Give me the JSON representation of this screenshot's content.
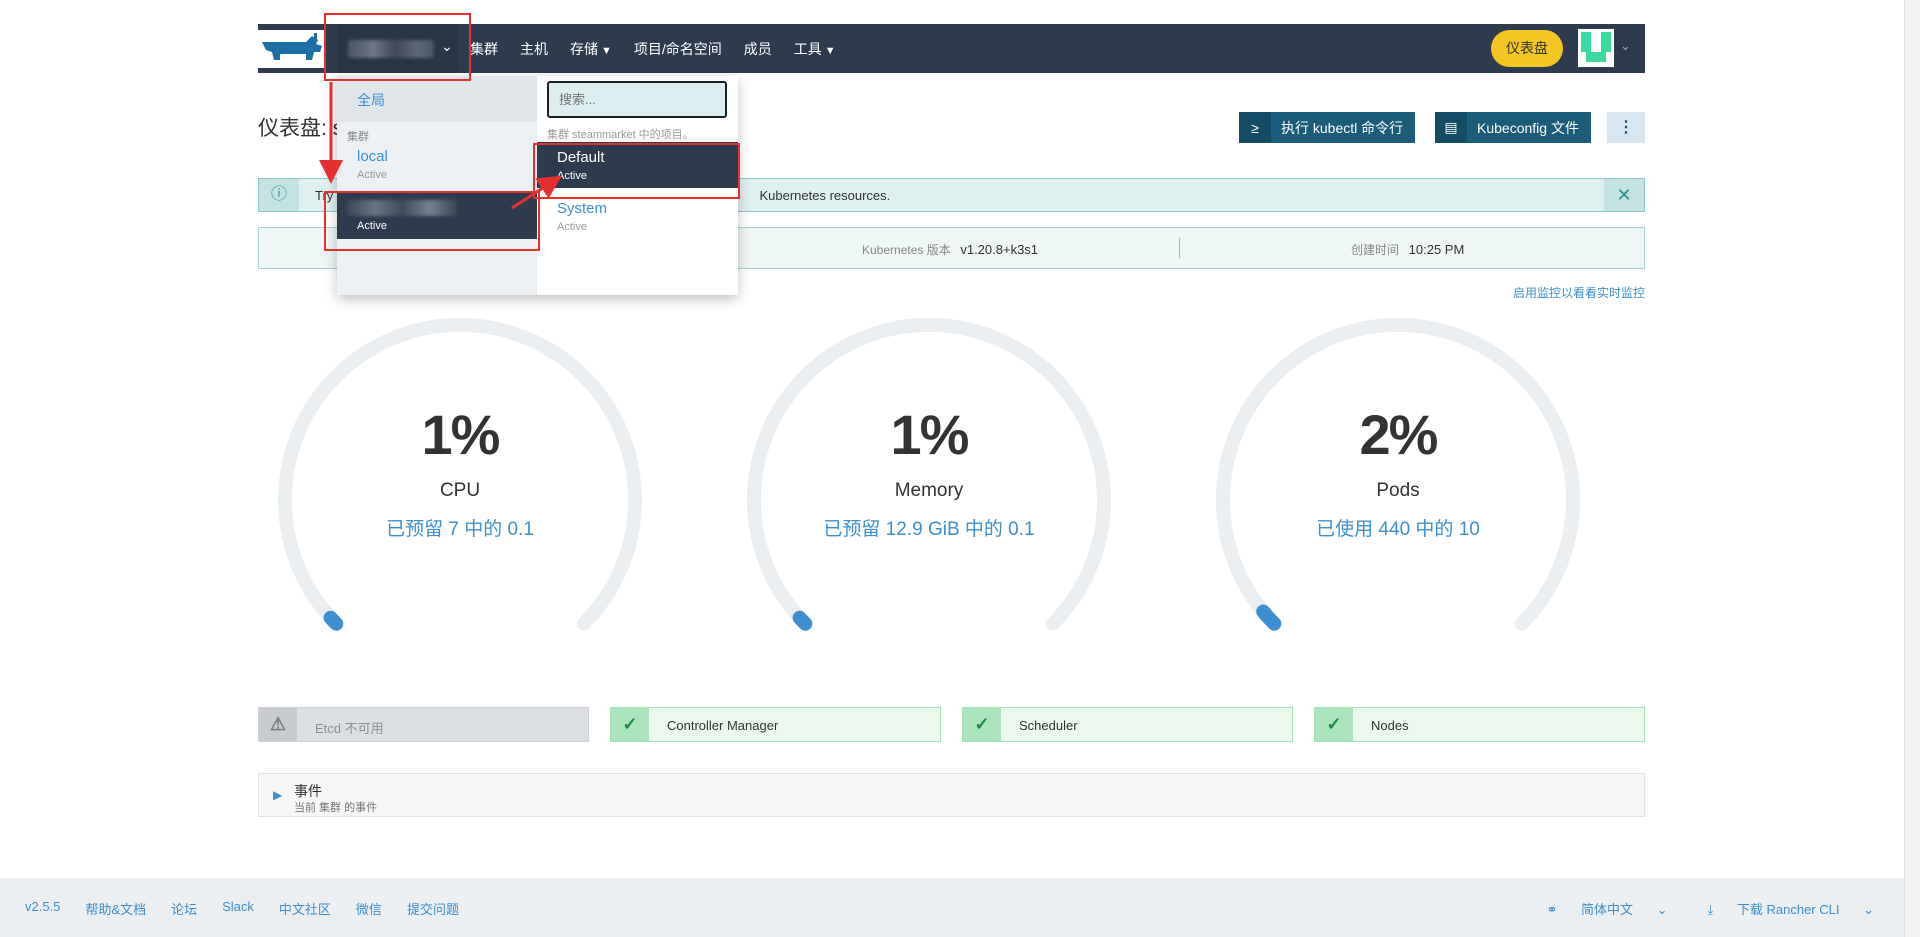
{
  "header": {
    "logo_icon": "rancher-cow-logo",
    "cluster_chevron": "chevron-down-icon",
    "nav": [
      {
        "label": "集群",
        "caret": false
      },
      {
        "label": "主机",
        "caret": false
      },
      {
        "label": "存储",
        "caret": true
      },
      {
        "label": "项目/命名空间",
        "caret": false
      },
      {
        "label": "成员",
        "caret": false
      },
      {
        "label": "工具",
        "caret": true
      }
    ],
    "dashboard_button": "仪表盘",
    "avatar_icon": "user-avatar-identicon"
  },
  "page": {
    "title": "仪表盘: s",
    "kubectl_button": "执行 kubectl 命令行",
    "kubeconfig_button": "Kubeconfig 文件",
    "more_icon": "more-vertical-icon"
  },
  "banner": {
    "text": "Try                                                                                                                      Kubernetes resources.",
    "close_icon": "close-icon"
  },
  "cluster_info": {
    "k8s_label": "Kubernetes 版本",
    "k8s_value": "v1.20.8+k3s1",
    "created_label": "创建时间",
    "created_value": "10:25 PM"
  },
  "monitor_link": "启用监控以看看实时监控",
  "gauges": [
    {
      "percent_text": "1%",
      "percent": 0.01,
      "name": "CPU",
      "detail": "已预留 7 中的 0.1"
    },
    {
      "percent_text": "1%",
      "percent": 0.01,
      "name": "Memory",
      "detail": "已预留 12.9 GiB 中的 0.1"
    },
    {
      "percent_text": "2%",
      "percent": 0.02,
      "name": "Pods",
      "detail": "已使用 440 中的 10"
    }
  ],
  "components": [
    {
      "label": "Etcd 不可用",
      "status": "unavailable"
    },
    {
      "label": "Controller Manager",
      "status": "ok"
    },
    {
      "label": "Scheduler",
      "status": "ok"
    },
    {
      "label": "Nodes",
      "status": "ok"
    }
  ],
  "events": {
    "title": "事件",
    "subtitle": "当前 集群 的事件"
  },
  "footer": {
    "links": [
      "v2.5.5",
      "帮助&文档",
      "论坛",
      "Slack",
      "中文社区",
      "微信",
      "提交问题"
    ],
    "language": "简体中文",
    "download": "下载 Rancher CLI"
  },
  "dropdown": {
    "global": "全局",
    "section_label": "集群",
    "clusters": [
      {
        "name": "local",
        "status": "Active",
        "selected": false
      },
      {
        "name": "",
        "status": "Active",
        "selected": true
      }
    ],
    "search_placeholder": "搜索...",
    "hint": "集群 steammarket 中的项目。",
    "projects": [
      {
        "name": "Default",
        "status": "Active",
        "selected": true
      },
      {
        "name": "System",
        "status": "Active",
        "selected": false
      }
    ]
  },
  "colors": {
    "header_bg": "#2e3b4e",
    "accent_blue": "#3d8fd1",
    "dashboard_yellow": "#f4c624",
    "annotation_red": "#e53030"
  }
}
